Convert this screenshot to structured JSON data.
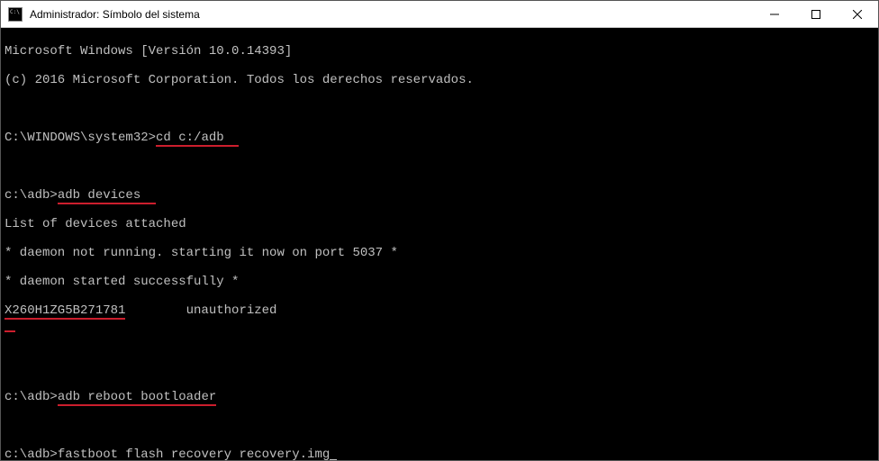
{
  "titlebar": {
    "title": "Administrador: Símbolo del sistema"
  },
  "terminal": {
    "line1": "Microsoft Windows [Versión 10.0.14393]",
    "line2": "(c) 2016 Microsoft Corporation. Todos los derechos reservados.",
    "prompt1": "C:\\WINDOWS\\system32>",
    "cmd1": "cd c:/adb",
    "prompt2": "c:\\adb>",
    "cmd2": "adb devices",
    "out1": "List of devices attached",
    "out2": "* daemon not running. starting it now on port 5037 *",
    "out3": "* daemon started successfully *",
    "out4a": "X260H1ZG5B271781",
    "out4b": "        unauthorized",
    "prompt3": "c:\\adb>",
    "cmd3": "adb reboot bootloader",
    "prompt4": "c:\\adb>",
    "cmd4": "fastboot flash recovery recovery.img"
  }
}
